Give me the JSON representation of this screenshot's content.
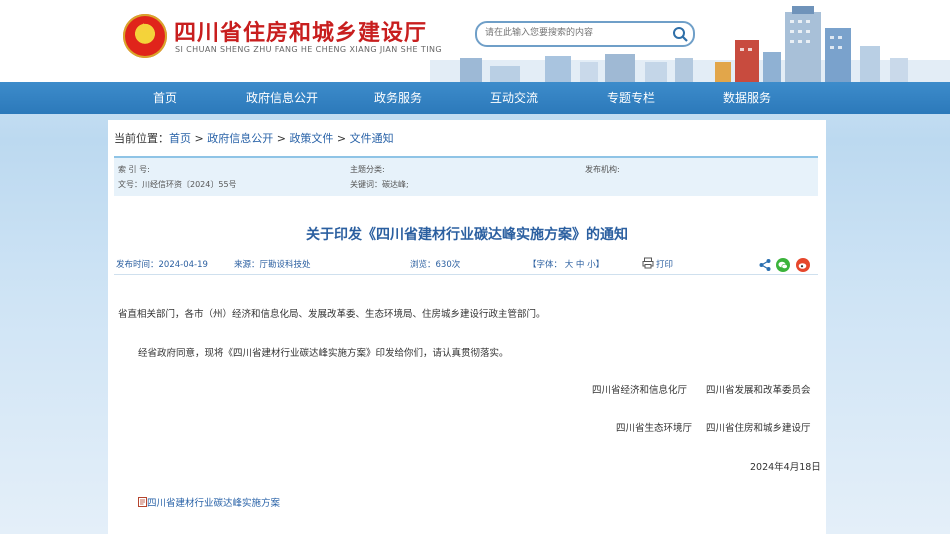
{
  "header": {
    "title": "四川省住房和城乡建设厅",
    "pinyin": "SI CHUAN SHENG ZHU FANG HE CHENG XIANG JIAN SHE TING",
    "search_placeholder": "请在此输入您要搜索的内容"
  },
  "nav": {
    "items": [
      "首页",
      "政府信息公开",
      "政务服务",
      "互动交流",
      "专题专栏",
      "数据服务"
    ]
  },
  "breadcrumb": {
    "prefix": "当前位置：",
    "items": [
      "首页",
      "政府信息公开",
      "政策文件",
      "文件通知"
    ],
    "separator": " > "
  },
  "meta": {
    "index_label": "索 引 号:",
    "theme_label": "主题分类:",
    "publisher_label": "发布机构:",
    "doc_no": "文号：川经信环资〔2024〕55号",
    "keywords": "关键词：碳达峰;"
  },
  "article": {
    "title": "关于印发《四川省建材行业碳达峰实施方案》的通知",
    "date": "发布时间：2024-04-19",
    "source": "来源：厅勘设科技处",
    "views": "浏览：630次",
    "font_size": "【字体： 大 中 小】",
    "print": "打印",
    "recipients": "省直相关部门，各市（州）经济和信息化局、发展改革委、生态环境局、住房城乡建设行政主管部门。",
    "body": "经省政府同意，现将《四川省建材行业碳达峰实施方案》印发给你们，请认真贯彻落实。",
    "signers": [
      [
        "四川省经济和信息化厅",
        "四川省发展和改革委员会"
      ],
      [
        "四川省生态环境厅",
        "四川省住房和城乡建设厅"
      ]
    ],
    "sign_date": "2024年4月18日",
    "attachment": "四川省建材行业碳达峰实施方案"
  },
  "colors": {
    "nav": "#2f7cbd",
    "title": "#c81e1e",
    "link": "#2a63a8"
  },
  "icons": [
    "emblem-icon",
    "search-icon",
    "print-icon",
    "share-icon",
    "wechat-icon",
    "weibo-icon",
    "attachment-icon"
  ]
}
